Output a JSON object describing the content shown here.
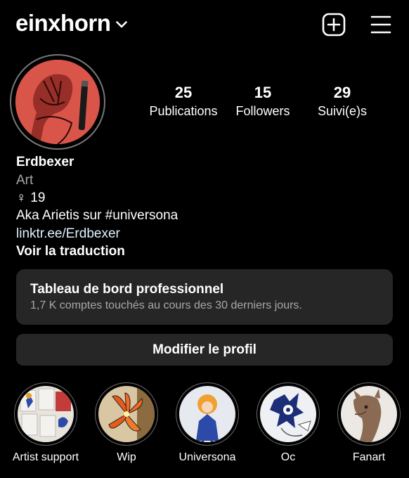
{
  "header": {
    "username": "einxhorn"
  },
  "stats": [
    {
      "value": "25",
      "label": "Publications"
    },
    {
      "value": "15",
      "label": "Followers"
    },
    {
      "value": "29",
      "label": "Suivi(e)s"
    }
  ],
  "bio": {
    "name": "Erdbexer",
    "category": "Art",
    "pronoun_symbol": "♀",
    "age": "19",
    "text": "Aka Arietis sur #universona",
    "link": "linktr.ee/Erdbexer",
    "translate": "Voir la traduction"
  },
  "dashboard": {
    "title": "Tableau de bord professionnel",
    "subtitle": "1,7 K comptes touchés au cours des 30 derniers jours."
  },
  "edit_profile": "Modifier le profil",
  "highlights": [
    {
      "label": "Artist support"
    },
    {
      "label": "Wip"
    },
    {
      "label": "Universona"
    },
    {
      "label": "Oc"
    },
    {
      "label": "Fanart"
    }
  ],
  "colors": {
    "background": "#000000",
    "card": "#262626",
    "secondary_text": "#a8a8a8",
    "link": "#e0f1ff",
    "avatar_red": "#d9554a"
  }
}
